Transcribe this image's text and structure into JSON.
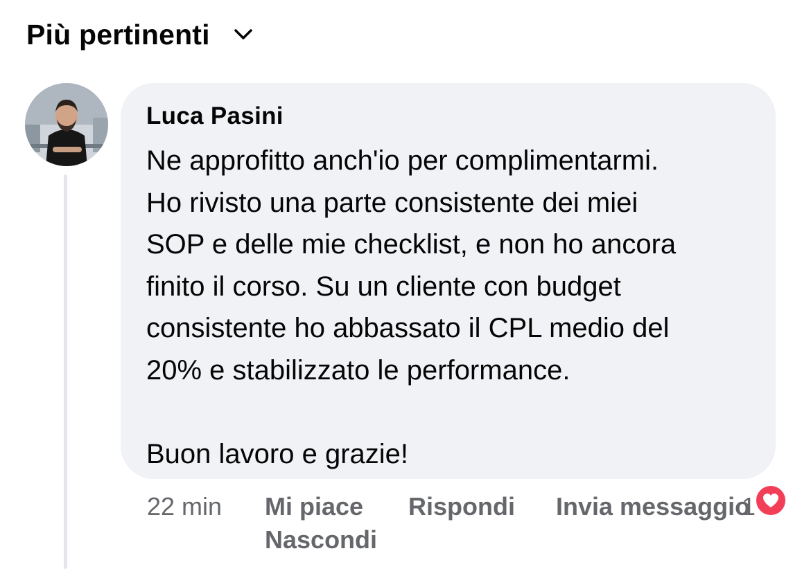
{
  "sort": {
    "label": "Più pertinenti",
    "icon": "chevron-down-icon"
  },
  "comment": {
    "author": "Luca Pasini",
    "text": "Ne approfitto anch'io per complimentarmi.\nHo rivisto una parte consistente dei miei\nSOP e delle mie checklist, e non ho ancora\nfinito il corso. Su un cliente con budget\nconsistente ho abbassato il CPL medio del\n20% e stabilizzato le performance.\n\nBuon lavoro e grazie!",
    "avatar_icon": "profile-photo"
  },
  "actions": {
    "time": "22 min",
    "like_label": "Mi piace",
    "reply_label": "Rispondi",
    "message_label": "Invia messaggio",
    "hide_label": "Nascondi",
    "reaction_count": "1",
    "reaction_icon": "heart-icon"
  },
  "colors": {
    "bubble": "#f0f2f5",
    "secondary_text": "#65676b",
    "heart": "#f33e58"
  }
}
